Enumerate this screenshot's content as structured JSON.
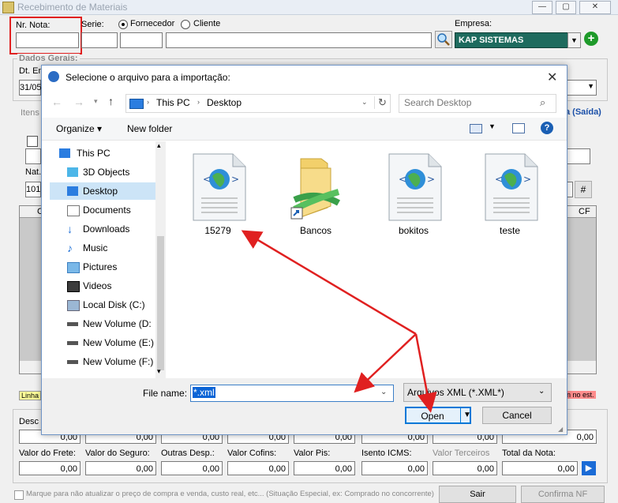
{
  "window": {
    "title": "Recebimento de Materiais",
    "controls": [
      "—",
      "▢",
      "✕"
    ]
  },
  "form": {
    "nr_nota_label": "Nr. Nota:",
    "serie_label": "Serie:",
    "fornecedor_label": "Fornecedor",
    "cliente_label": "Cliente",
    "empresa_label": "Empresa:",
    "empresa_value": "KAP SISTEMAS",
    "dados_gerais_label": "Dados Gerais:",
    "dt_label": "Dt. En",
    "dt_value": "31/05",
    "itens_label": "Itens",
    "saida_text": "a (Saída)",
    "nat_label": "Nat.",
    "nat_value": "101",
    "hash_button": "#",
    "cf_header": "CF",
    "c_header": "C",
    "linha_label": "Linha",
    "nao_est_label": "n no est.",
    "desc_label": "Desc",
    "desc_values": [
      "0,00",
      "0,00",
      "0,00",
      "0,00",
      "0,00",
      "0,00",
      "0,00",
      "0,00"
    ],
    "totals_labels": [
      "Valor do Frete:",
      "Valor do Seguro:",
      "Outras Desp.:",
      "Valor Cofins:",
      "Valor Pis:",
      "Isento ICMS:",
      "Valor Terceiros",
      "Total da Nota:"
    ],
    "totals_values": [
      "0,00",
      "0,00",
      "0,00",
      "0,00",
      "0,00",
      "0,00",
      "0,00",
      "0,00"
    ],
    "checkbox_label": "Marque para não atualizar o preço de compra e venda, custo real, etc... (Situação Especial, ex: Comprado no concorrente)",
    "sair_button": "Sair",
    "confirma_button": "Confirma NF"
  },
  "dialog": {
    "title": "Selecione o arquivo para a importação:",
    "breadcrumb": [
      "This PC",
      "Desktop"
    ],
    "search_placeholder": "Search Desktop",
    "organize_label": "Organize ▾",
    "new_folder_label": "New folder",
    "tree": [
      "This PC",
      "3D Objects",
      "Desktop",
      "Documents",
      "Downloads",
      "Music",
      "Pictures",
      "Videos",
      "Local Disk (C:)",
      "New Volume (D:",
      "New Volume (E:)",
      "New Volume (F:)"
    ],
    "files": [
      {
        "name": "15279",
        "kind": "doc"
      },
      {
        "name": "Bancos",
        "kind": "folder"
      },
      {
        "name": "bokitos",
        "kind": "doc"
      },
      {
        "name": "teste",
        "kind": "doc"
      }
    ],
    "file_name_label": "File name:",
    "file_name_value": "*.xml",
    "file_type_value": "Arquivos XML (*.XML*)",
    "open_button": "Open",
    "cancel_button": "Cancel"
  }
}
